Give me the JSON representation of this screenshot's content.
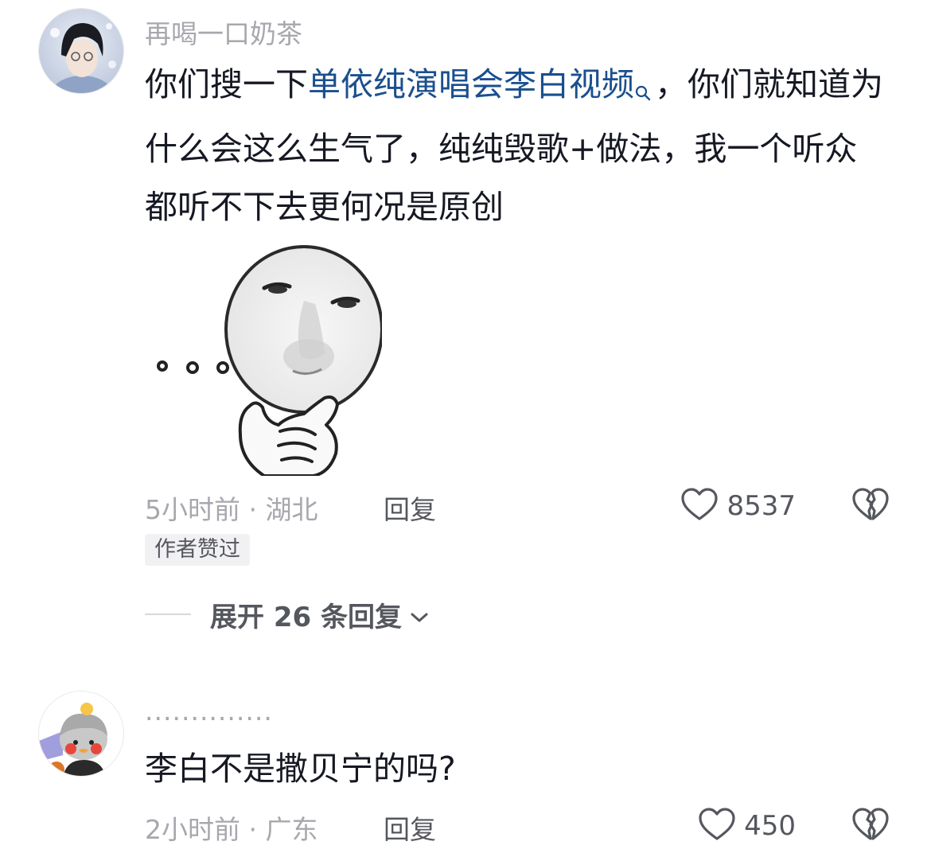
{
  "comments": [
    {
      "username": "再喝一口奶茶",
      "text_plain_1": "你们搜一下",
      "text_link": "单依纯演唱会李白视频",
      "text_plain_2": "，你们就知道为什么会这么生气了，纯纯毁歌+做法，我一个听众都听不下去更何况是原创",
      "meta": "5小时前 · 湖北",
      "reply_label": "回复",
      "like_count": "8537",
      "badge": "作者赞过",
      "expand_label": "展开 26 条回复"
    },
    {
      "username": "..............",
      "text": "李白不是撒贝宁的吗?",
      "meta": "2小时前 · 广东",
      "reply_label": "回复",
      "like_count": "450"
    }
  ],
  "colors": {
    "link": "#1a4f8e",
    "secondary_text": "#a7a8ad",
    "action_text": "#55575e",
    "badge_bg": "#f1f1f3"
  },
  "icons": [
    "heart-icon",
    "broken-heart-icon",
    "search-icon",
    "chevron-down-icon"
  ]
}
